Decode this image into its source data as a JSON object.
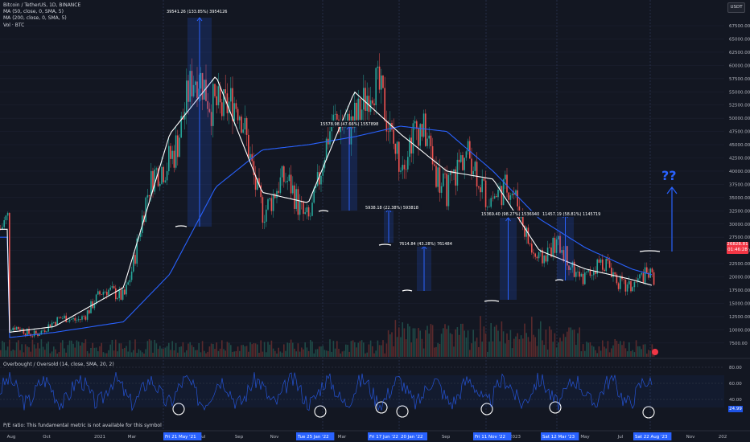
{
  "legend": {
    "title": "Bitcoin / TetherUS, 1D, BINANCE",
    "ma50": "MA (50, close, 0, SMA, 5)",
    "ma200": "MA (200, close, 0, SMA, 5)",
    "vol": "Vol · BTC"
  },
  "currency": "USDT",
  "last_price": {
    "value": "26828.81",
    "countdown": "01:46:28"
  },
  "oscillator": {
    "title": "Overbought / Oversold (14, close, SMA, 20, 2)",
    "current": "24.99",
    "ticks": [
      "80.00",
      "60.00",
      "40.00"
    ]
  },
  "pe_note": "P/E ratio: This fundamental metric is not available for this symbol",
  "question": "??",
  "colors": {
    "bg": "#131722",
    "ma50": "#ffffff",
    "ma200": "#2962ff",
    "up": "#26a69a",
    "down": "#ef5350",
    "measure": "#2962ff"
  },
  "chart_data": {
    "type": "line",
    "title": "Bitcoin / TetherUS, 1D, BINANCE",
    "y_ticks": [
      "67500.00",
      "65000.00",
      "62500.00",
      "60000.00",
      "57500.00",
      "55000.00",
      "52500.00",
      "50000.00",
      "47500.00",
      "45000.00",
      "42500.00",
      "40000.00",
      "37500.00",
      "35000.00",
      "32500.00",
      "30000.00",
      "27500.00",
      "25000.00",
      "22500.00",
      "20000.00",
      "17500.00",
      "15000.00",
      "12500.00",
      "10000.00",
      "7500.00"
    ],
    "x_ticks": [
      "Aug",
      "Oct",
      "2021",
      "Mar",
      "May",
      "Jul",
      "Sep",
      "Nov",
      "2022",
      "Mar",
      "May",
      "Jul",
      "Sep",
      "Nov",
      "2023",
      "May",
      "Jul",
      "Sep",
      "Nov",
      "202"
    ],
    "x_highlights": [
      "Fri 21 May '21",
      "Tue 25 Jan '22",
      "Fri 17 Jun '22",
      "20 Jan '22",
      "Fri 11 Nov '22",
      "Sat 12 Mar '23",
      "Sat 22 Aug '23"
    ],
    "series": [
      {
        "name": "MA (50, close, 0, SMA, 5)",
        "x": [
          "2020-08",
          "2020-10",
          "2021-01",
          "2021-03",
          "2021-05",
          "2021-07",
          "2021-09",
          "2021-11",
          "2022-01",
          "2022-03",
          "2022-05",
          "2022-07",
          "2022-09",
          "2022-11",
          "2023-01",
          "2023-03",
          "2023-05",
          "2023-07",
          "2023-09"
        ],
        "values": [
          9500,
          10600,
          18000,
          47000,
          58000,
          36000,
          34000,
          55000,
          47000,
          40000,
          38500,
          25000,
          21500,
          19500,
          17000,
          24000,
          28500,
          29500,
          29000
        ]
      },
      {
        "name": "MA (200, close, 0, SMA, 5)",
        "x": [
          "2020-08",
          "2020-10",
          "2021-01",
          "2021-03",
          "2021-05",
          "2021-07",
          "2021-09",
          "2021-11",
          "2022-01",
          "2022-03",
          "2022-05",
          "2022-07",
          "2022-09",
          "2022-11",
          "2023-01",
          "2023-03",
          "2023-05",
          "2023-07",
          "2023-09"
        ],
        "values": [
          8500,
          9500,
          11500,
          20500,
          37000,
          44000,
          45000,
          46500,
          48500,
          47500,
          40000,
          31000,
          25500,
          21500,
          19000,
          20000,
          24000,
          26000,
          27500
        ]
      }
    ],
    "measurements": [
      "39541.26 (133.85%) 3954126",
      "15578.98 (47.66%) 1557898",
      "5938.18 (22.38%) 593818",
      "7614.84 (43.28%) 761484",
      "15369.40 (98.27%) 1536940",
      "11457.19 (58.81%) 1145719"
    ],
    "oscillator_ticks": [
      "80.00",
      "60.00",
      "40.00"
    ],
    "oscillator_current": 24.99,
    "ylim": [
      7500,
      67500
    ]
  }
}
